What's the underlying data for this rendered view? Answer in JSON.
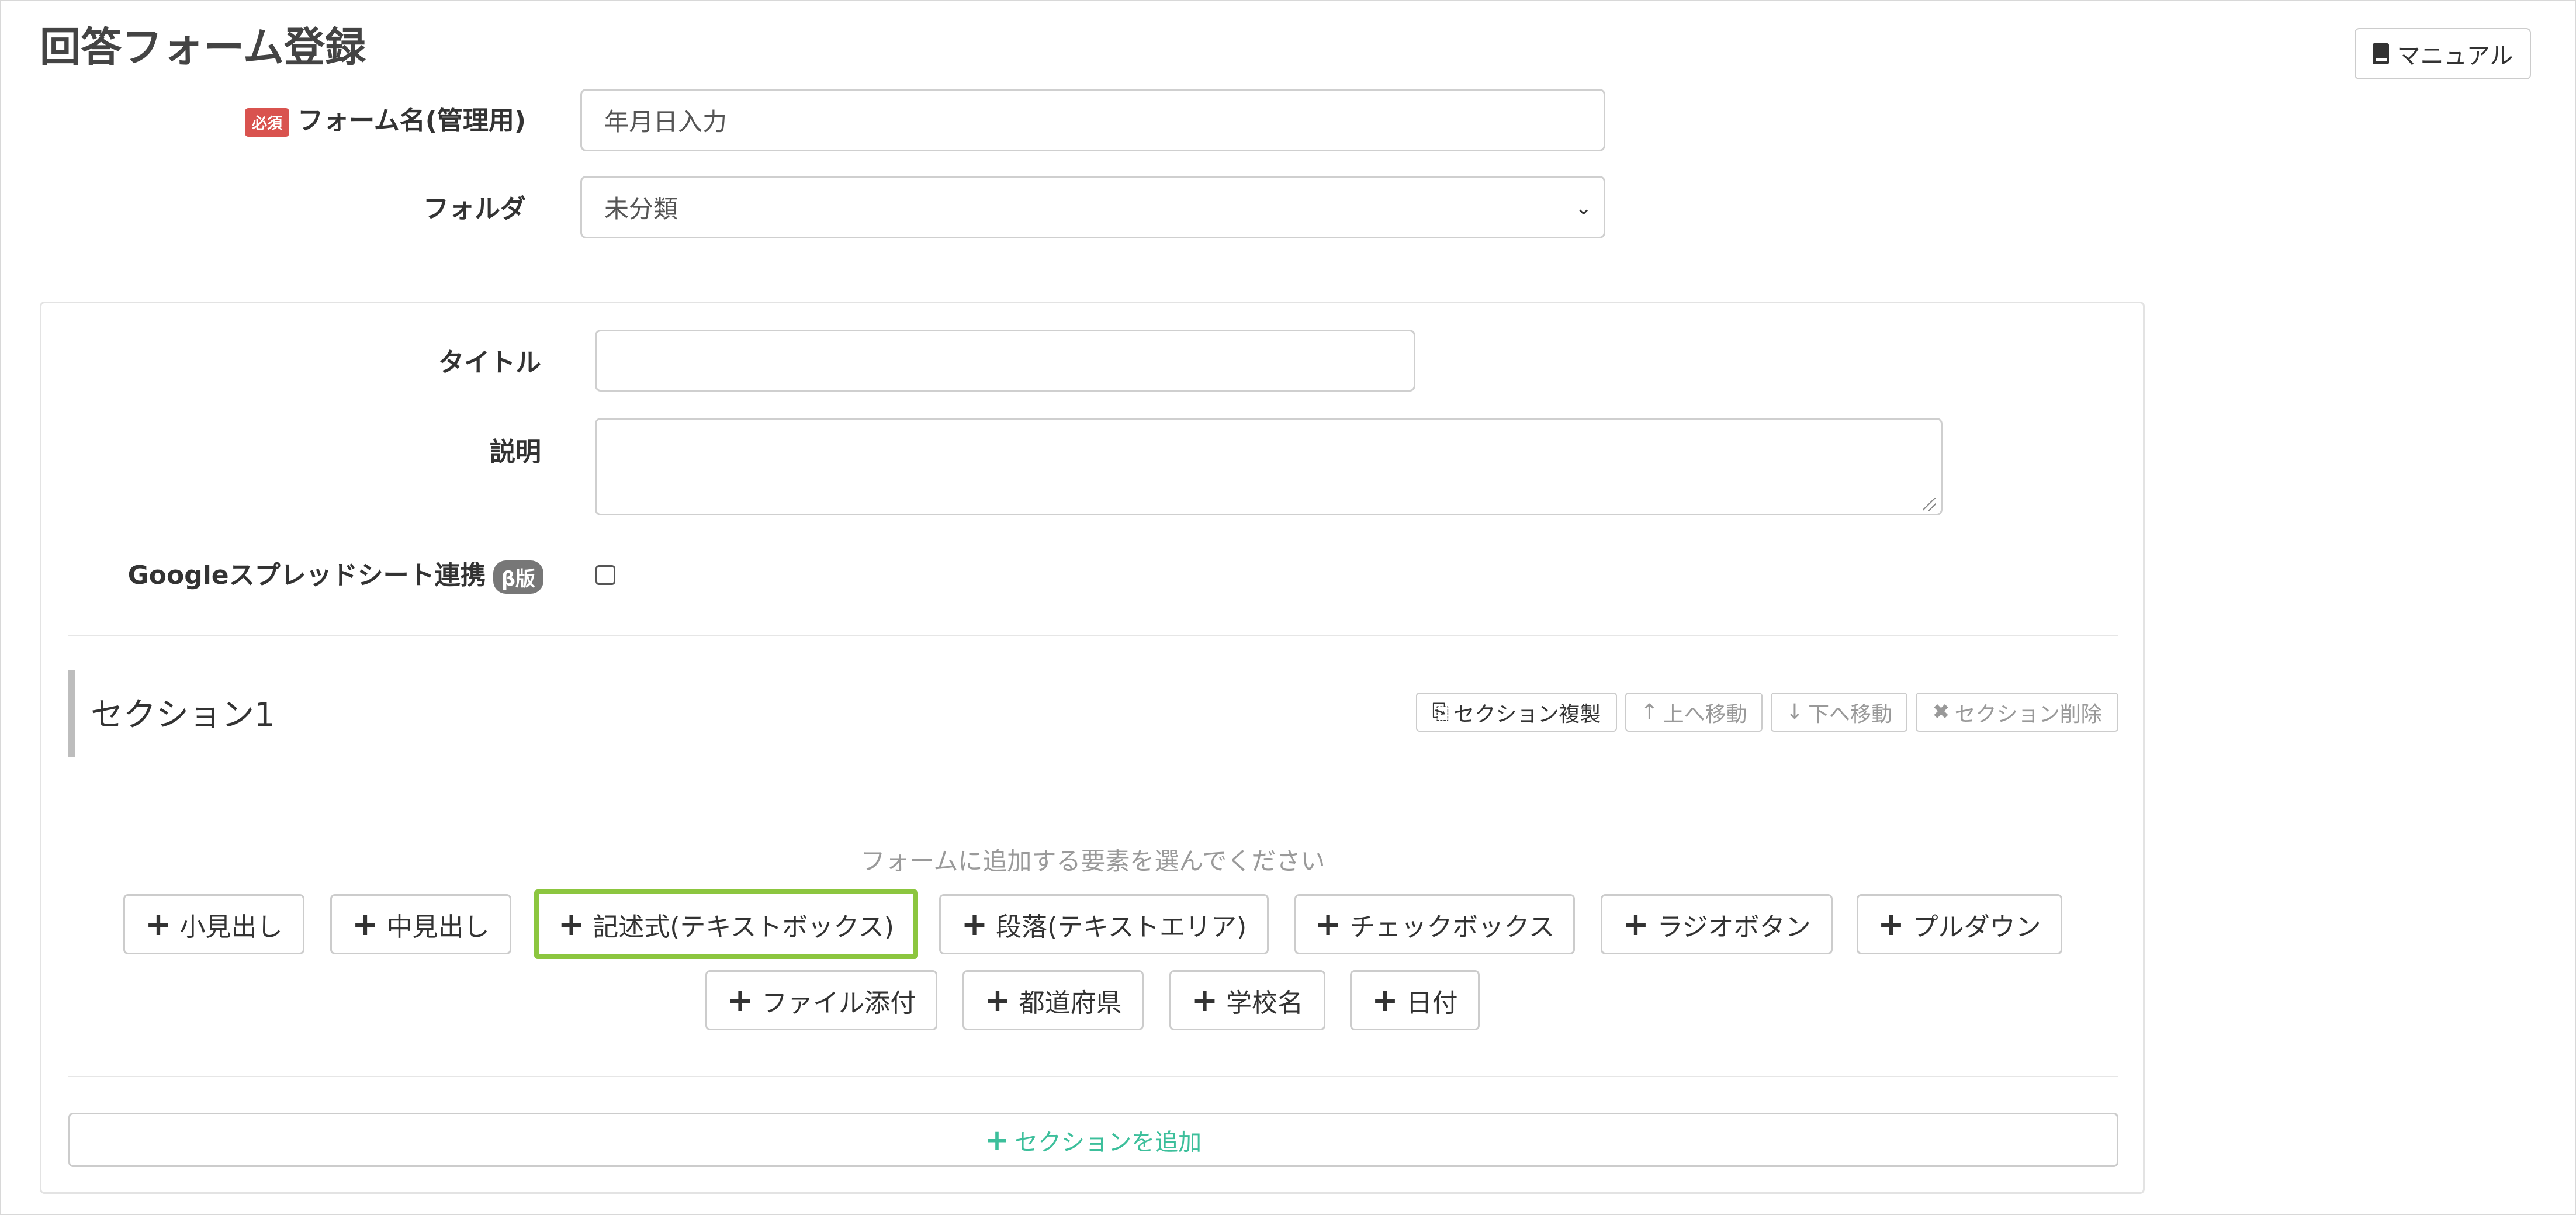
{
  "page": {
    "title": "回答フォーム登録"
  },
  "header": {
    "manual_label": "マニュアル"
  },
  "form": {
    "name": {
      "required_badge": "必須",
      "label": "フォーム名(管理用)",
      "value": "年月日入力"
    },
    "folder": {
      "label": "フォルダ",
      "selected": "未分類"
    }
  },
  "panel": {
    "title_label": "タイトル",
    "title_value": "",
    "description_label": "説明",
    "description_value": "",
    "sheets_label": "Googleスプレッドシート連携",
    "beta_badge": "β版",
    "sheets_checked": false
  },
  "section": {
    "title": "セクション1",
    "actions": {
      "duplicate": "セクション複製",
      "move_up": "上へ移動",
      "move_down": "下へ移動",
      "delete": "セクション削除"
    },
    "hint": "フォームに追加する要素を選んでください",
    "elements_row1": [
      "小見出し",
      "中見出し",
      "記述式(テキストボックス)",
      "段落(テキストエリア)",
      "チェックボックス",
      "ラジオボタン",
      "プルダウン"
    ],
    "elements_row2": [
      "ファイル添付",
      "都道府県",
      "学校名",
      "日付"
    ],
    "highlighted_element": "記述式(テキストボックス)"
  },
  "add_section_label": "セクションを追加",
  "colors": {
    "required": "#d9534f",
    "highlight": "#8cc63f",
    "add_section": "#3cbf9b",
    "beta": "#777777"
  },
  "icons": [
    "book-icon",
    "plus-icon",
    "copy-icon",
    "arrow-up-icon",
    "arrow-down-icon",
    "close-icon",
    "chevron-down-icon"
  ]
}
